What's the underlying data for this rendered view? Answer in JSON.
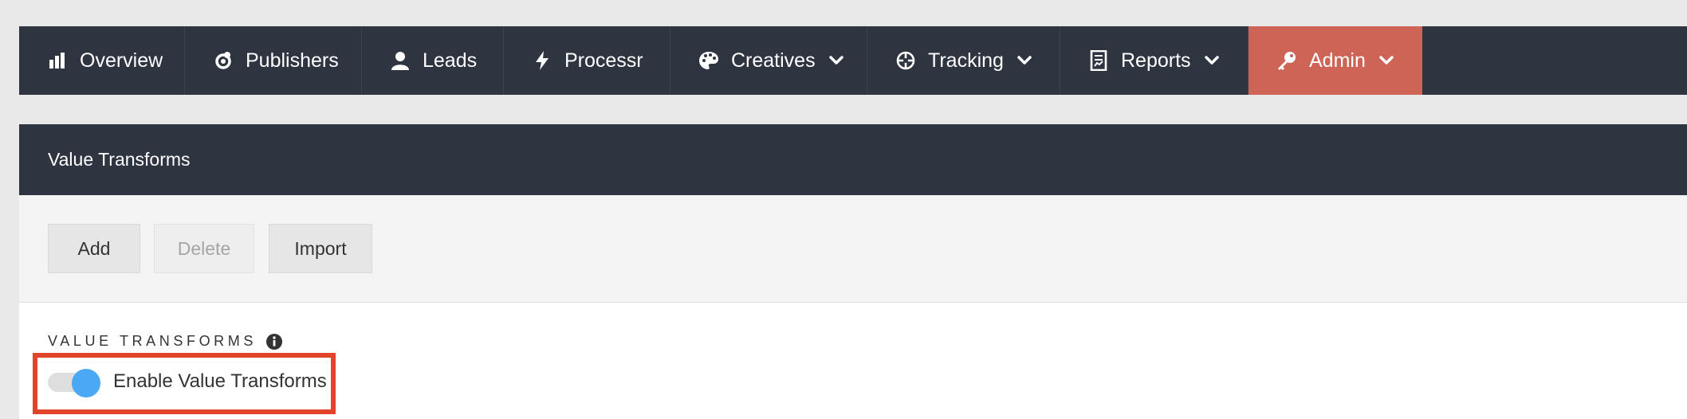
{
  "nav": {
    "items": [
      {
        "label": "Overview",
        "icon": "chart-icon",
        "has_dropdown": false
      },
      {
        "label": "Publishers",
        "icon": "publishers-icon",
        "has_dropdown": false
      },
      {
        "label": "Leads",
        "icon": "user-icon",
        "has_dropdown": false
      },
      {
        "label": "Processr",
        "icon": "bolt-icon",
        "has_dropdown": false
      },
      {
        "label": "Creatives",
        "icon": "palette-icon",
        "has_dropdown": true
      },
      {
        "label": "Tracking",
        "icon": "crosshair-icon",
        "has_dropdown": true
      },
      {
        "label": "Reports",
        "icon": "report-icon",
        "has_dropdown": true
      },
      {
        "label": "Admin",
        "icon": "key-icon",
        "has_dropdown": true,
        "active": true
      }
    ]
  },
  "panel": {
    "title": "Value Transforms"
  },
  "toolbar": {
    "add_label": "Add",
    "delete_label": "Delete",
    "import_label": "Import"
  },
  "section": {
    "label": "VALUE TRANSFORMS",
    "toggle_label": "Enable Value Transforms",
    "toggle_on": true
  },
  "colors": {
    "nav_bg": "#2e3440",
    "active_bg": "#cd6455",
    "toggle_on": "#4aa8f5",
    "highlight": "#e2432b"
  }
}
